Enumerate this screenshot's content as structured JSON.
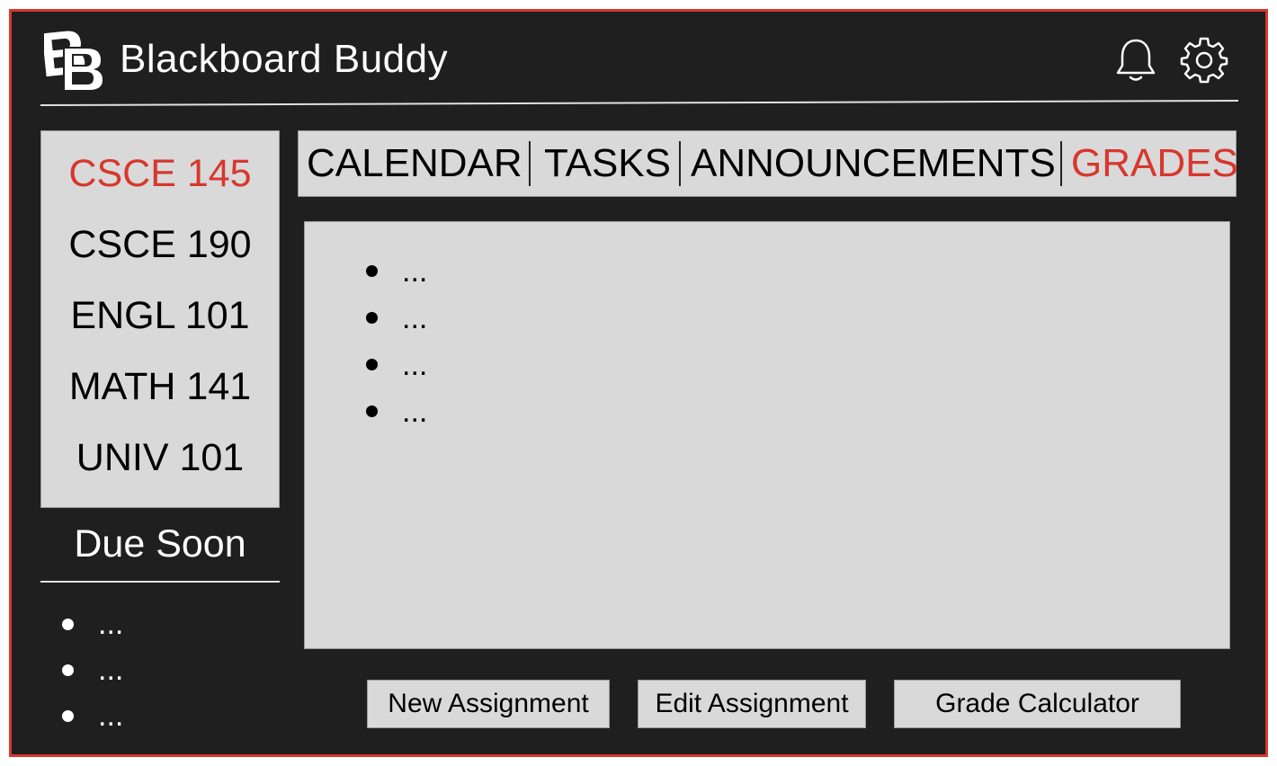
{
  "header": {
    "logo_text": "BB",
    "title": "Blackboard Buddy",
    "notification_icon": "bell-icon",
    "settings_icon": "gear-icon"
  },
  "sidebar": {
    "courses": [
      {
        "label": "CSCE 145",
        "active": true
      },
      {
        "label": "CSCE 190",
        "active": false
      },
      {
        "label": "ENGL 101",
        "active": false
      },
      {
        "label": "MATH 141",
        "active": false
      },
      {
        "label": "UNIV 101",
        "active": false
      }
    ],
    "due_soon": {
      "title": "Due Soon",
      "items": [
        "...",
        "...",
        "..."
      ]
    }
  },
  "tabs": [
    {
      "label": "CALENDAR",
      "active": false
    },
    {
      "label": "TASKS",
      "active": false
    },
    {
      "label": "ANNOUNCEMENTS",
      "active": false
    },
    {
      "label": "GRADES",
      "active": true
    }
  ],
  "content": {
    "items": [
      "...",
      "...",
      "...",
      "..."
    ]
  },
  "actions": {
    "new_assignment": "New Assignment",
    "edit_assignment": "Edit Assignment",
    "grade_calculator": "Grade Calculator"
  },
  "colors": {
    "accent": "#d7372d",
    "background": "#1f1f1f",
    "panel": "#d9d9d9"
  }
}
